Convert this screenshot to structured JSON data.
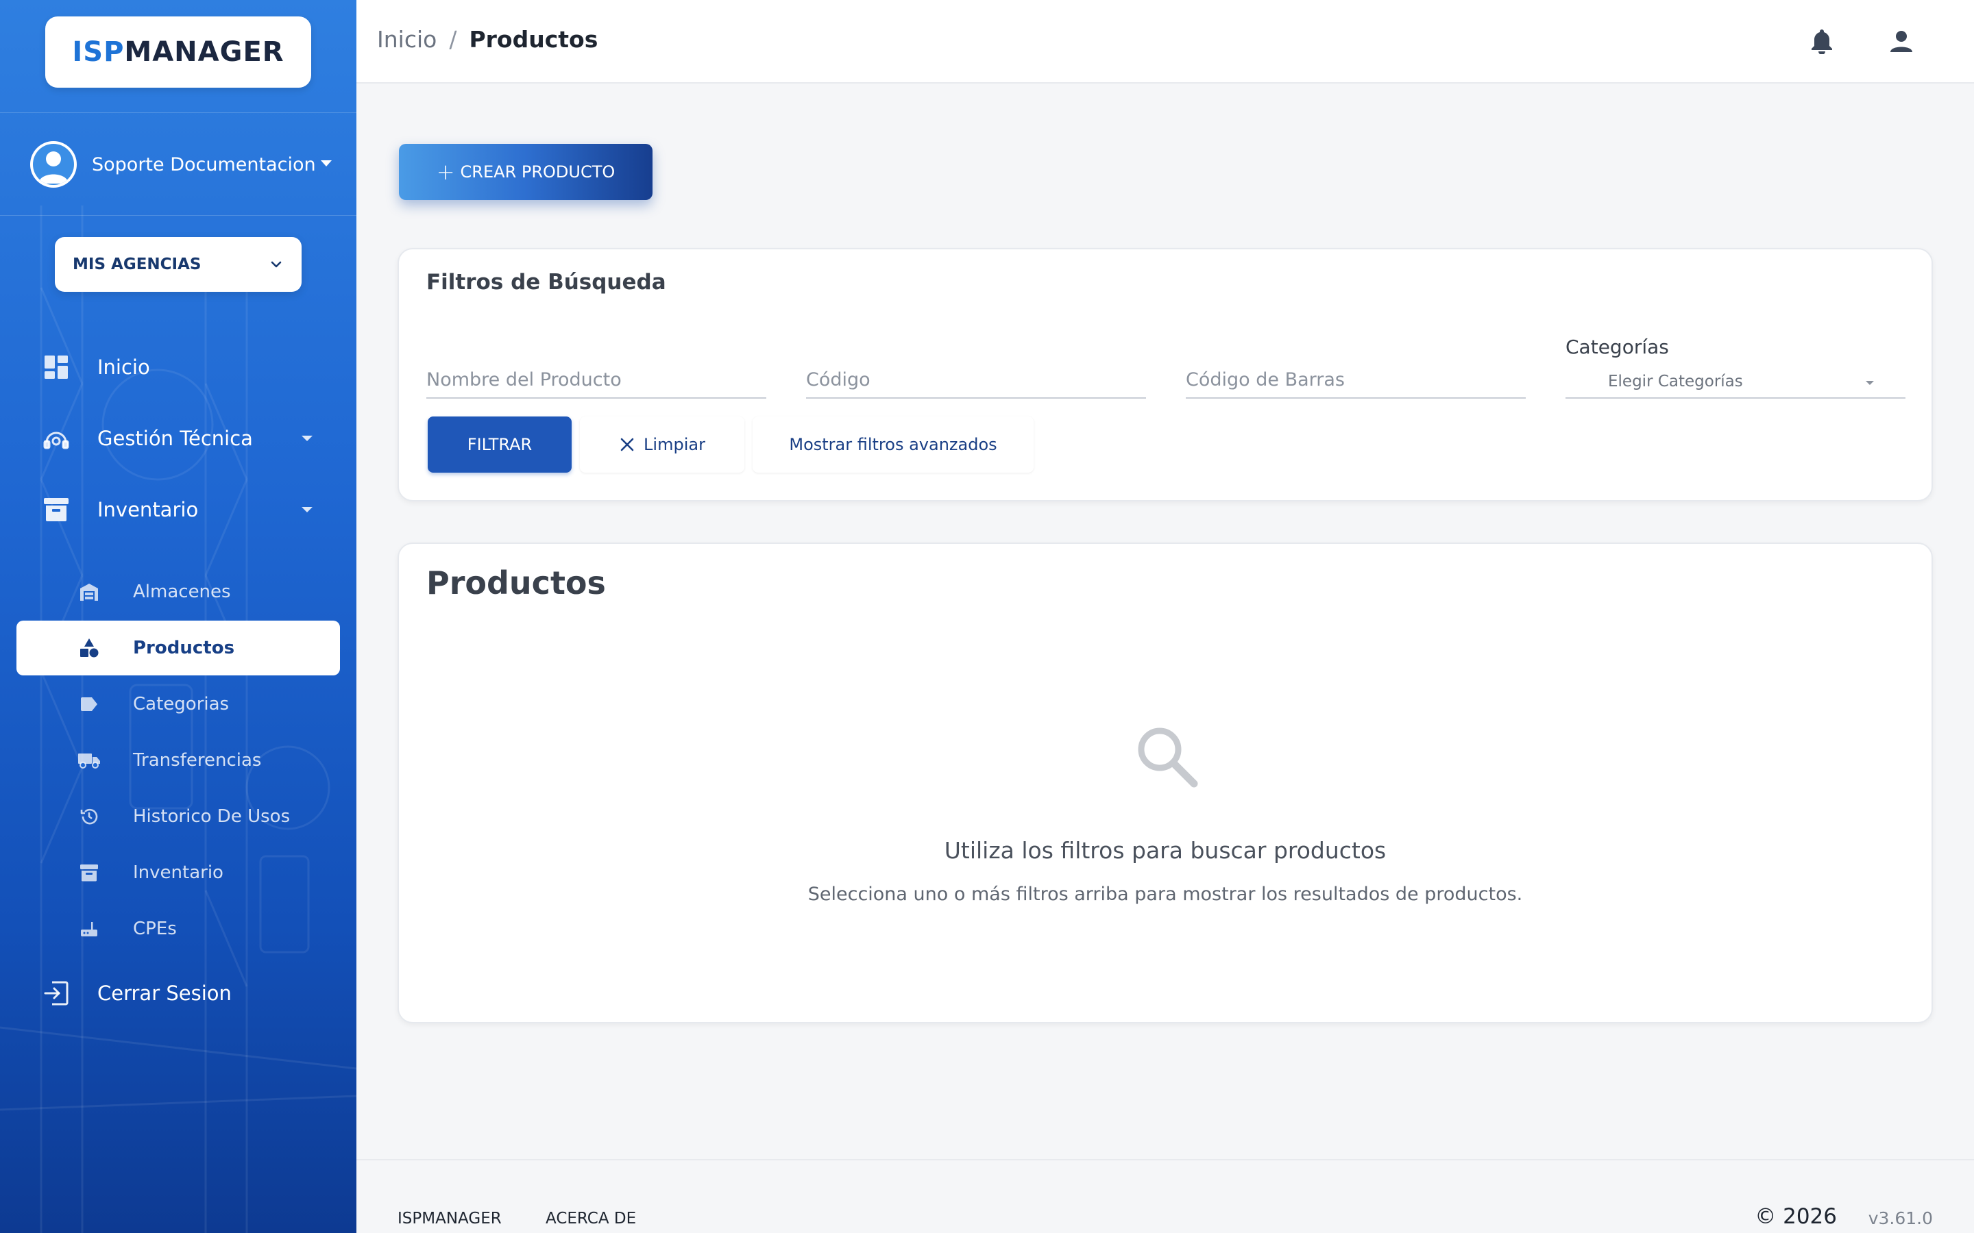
{
  "brand": {
    "logo_part1": "ISP",
    "logo_part2": "MANAGER",
    "accent": "#1e73d6"
  },
  "sidebar": {
    "user_name": "Soporte Documentacion",
    "agency_select": "MIS AGENCIAS",
    "nav": [
      {
        "label": "Inicio",
        "icon": "dashboard-icon"
      },
      {
        "label": "Gestión Técnica",
        "icon": "technician-icon"
      },
      {
        "label": "Inventario",
        "icon": "archive-icon"
      }
    ],
    "inventory_items": [
      {
        "label": "Almacenes",
        "icon": "warehouse-icon"
      },
      {
        "label": "Productos",
        "icon": "shapes-icon",
        "active": true
      },
      {
        "label": "Categorias",
        "icon": "tag-icon"
      },
      {
        "label": "Transferencias",
        "icon": "truck-icon"
      },
      {
        "label": "Historico De Usos",
        "icon": "history-icon"
      },
      {
        "label": "Inventario",
        "icon": "archive-icon"
      },
      {
        "label": "CPEs",
        "icon": "router-icon"
      }
    ],
    "logout": "Cerrar Sesion"
  },
  "topbar": {
    "breadcrumb_home": "Inicio",
    "breadcrumb_sep": "/",
    "breadcrumb_current": "Productos"
  },
  "main": {
    "create_button": "CREAR PRODUCTO",
    "filters": {
      "title": "Filtros de Búsqueda",
      "name_placeholder": "Nombre del Producto",
      "code_placeholder": "Código",
      "barcode_placeholder": "Código de Barras",
      "categories_label": "Categorías",
      "categories_placeholder": "Elegir Categorías",
      "filter_button": "FILTRAR",
      "clear_button": "Limpiar",
      "advanced_button": "Mostrar filtros avanzados"
    },
    "products": {
      "title": "Productos",
      "empty_title": "Utiliza los filtros para buscar productos",
      "empty_subtitle": "Selecciona uno o más filtros arriba para mostrar los resultados de productos."
    }
  },
  "footer": {
    "link1": "ISPMANAGER",
    "link2": "ACERCA DE",
    "copyright": "© 2026",
    "version": "v3.61.0"
  }
}
